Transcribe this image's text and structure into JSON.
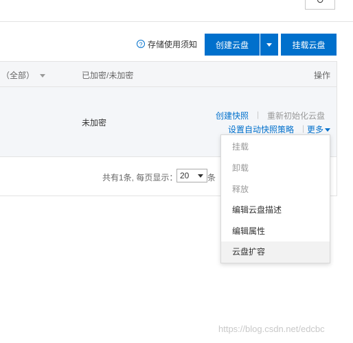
{
  "toolbar": {
    "refresh_icon": "↻",
    "storage_notice": "存储使用须知",
    "help_icon": "?",
    "create_disk_label": "创建云盘",
    "mount_disk_label": "挂载云盘"
  },
  "table": {
    "headers": {
      "filter_all": "（全部）",
      "encryption": "已加密/未加密",
      "actions": "操作"
    },
    "row": {
      "encryption": "未加密",
      "create_snapshot": "创建快照",
      "reinit_disk": "重新初始化云盘",
      "auto_snapshot_policy": "设置自动快照策略",
      "more": "更多",
      "separator": "|"
    }
  },
  "pagination": {
    "summary": "共有1条, 每页显示：",
    "page_size": "20",
    "unit": "条"
  },
  "more_menu": {
    "items": [
      {
        "label": "挂载",
        "enabled": false
      },
      {
        "label": "卸载",
        "enabled": false
      },
      {
        "label": "释放",
        "enabled": false
      },
      {
        "label": "编辑云盘描述",
        "enabled": true
      },
      {
        "label": "编辑属性",
        "enabled": true
      },
      {
        "label": "云盘扩容",
        "enabled": true,
        "hover": true
      }
    ]
  },
  "watermark": "https://blog.csdn.net/edcbc",
  "colors": {
    "accent": "#0070cc",
    "disabled_text": "#999999"
  }
}
